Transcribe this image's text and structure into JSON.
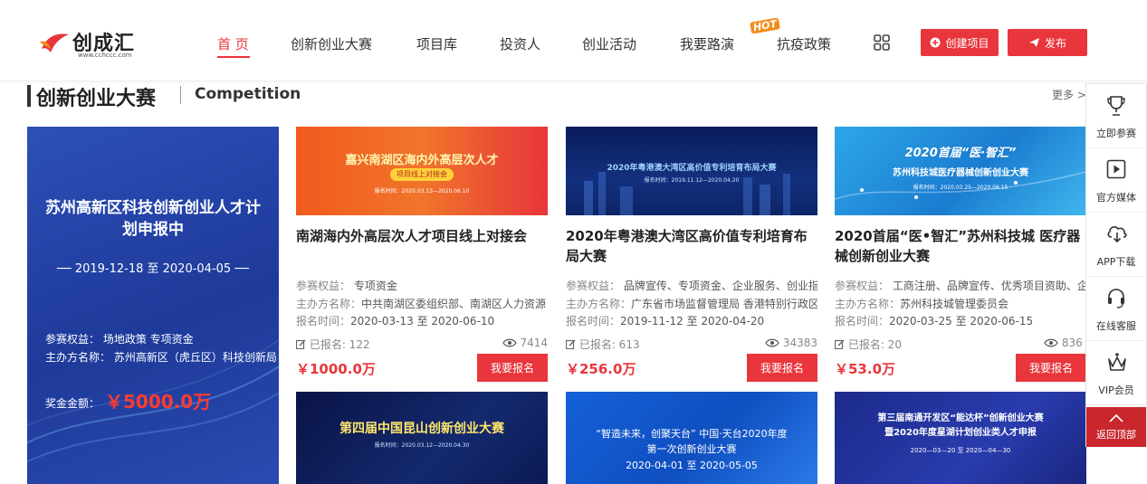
{
  "header": {
    "logo_text": "创成汇",
    "logo_url_text": "www.cchccc.com",
    "nav": [
      {
        "label": "首 页"
      },
      {
        "label": "创新创业大赛"
      },
      {
        "label": "项目库"
      },
      {
        "label": "投资人"
      },
      {
        "label": "创业活动"
      },
      {
        "label": "我要路演"
      },
      {
        "label": "抗疫政策"
      }
    ],
    "hot_badge": "HOT",
    "create_project_label": "创建项目",
    "publish_label": "发布"
  },
  "section": {
    "title": "创新创业大赛",
    "subtitle": "Competition",
    "more": "更多 >>"
  },
  "feature": {
    "title": "苏州高新区科技创新创业人才计划申报中",
    "dates": "── 2019-12-18 至 2020-04-05 ──",
    "benefit": "参赛权益： 场地政策 专项资金",
    "organizer": "主办方名称： 苏州高新区（虎丘区）科技创新局",
    "prize_label": "奖金金额：",
    "prize": "￥5000.0万"
  },
  "cards": [
    {
      "banner_title": "嘉兴南湖区海内外高层次人才",
      "banner_tag": "项目线上对接会",
      "banner_date": "报名时间：2020.03.13—2020.06.10",
      "title": "南湖海内外高层次人才项目线上对接会",
      "benefit_label": "参赛权益：",
      "benefit": "专项资金",
      "organizer_label": "主办方名称：",
      "organizer": "中共南湖区委组织部、南湖区人力资源",
      "time_label": "报名时间：",
      "time": "2020-03-13 至 2020-06-10",
      "signup": "已报名: 122",
      "views": "7414",
      "price": "￥1000.0万",
      "button": "我要报名"
    },
    {
      "banner_title": "2020年粤港澳大湾区高价值专利培育布局大赛",
      "banner_tag": "",
      "banner_date": "报名时间：2019.11.12—2020.04.20",
      "title": "2020年粤港澳大湾区高价值专利培育布局大赛",
      "benefit_label": "参赛权益：",
      "benefit": "品牌宣传、专项资金、企业服务、创业指",
      "organizer_label": "主办方名称：",
      "organizer": "广东省市场监督管理局 香港特别行政区",
      "time_label": "报名时间：",
      "time": "2019-11-12 至 2020-04-20",
      "signup": "已报名: 613",
      "views": "34383",
      "price": "￥256.0万",
      "button": "我要报名"
    },
    {
      "banner_title": "2020首届“医·智汇”",
      "banner_tag": "苏州科技城医疗器械创新创业大赛",
      "banner_date": "报名时间：2020.03.25—2020.06.15",
      "title": "2020首届“医•智汇”苏州科技城 医疗器械创新创业大赛",
      "benefit_label": "参赛权益：",
      "benefit": "工商注册、品牌宣传、优秀项目资助、企",
      "organizer_label": "主办方名称：",
      "organizer": "苏州科技城管理委员会",
      "time_label": "报名时间：",
      "time": "2020-03-25 至 2020-06-15",
      "signup": "已报名: 20",
      "views": "836",
      "price": "￥53.0万",
      "button": "我要报名"
    }
  ],
  "bottom_banners": [
    {
      "title": "第四届中国昆山创新创业大赛",
      "line2": "报名时间：2020.03.12—2020.04.30",
      "line3": ""
    },
    {
      "title": "“智造未来，创聚天台” 中国·天台2020年度",
      "line2": "第一次创新创业大赛",
      "line3": "2020-04-01 至 2020-05-05"
    },
    {
      "title": "第三届南通开发区“能达杯”创新创业大赛",
      "line2": "暨2020年度星湖计划创业类人才申报",
      "line3": "2020—03—20 至 2020—04—30"
    }
  ],
  "sidebar": {
    "items": [
      {
        "label": "立即参赛"
      },
      {
        "label": "官方媒体"
      },
      {
        "label": "APP下载"
      },
      {
        "label": "在线客服"
      },
      {
        "label": "VIP会员"
      }
    ],
    "back_top": "返回顶部"
  }
}
